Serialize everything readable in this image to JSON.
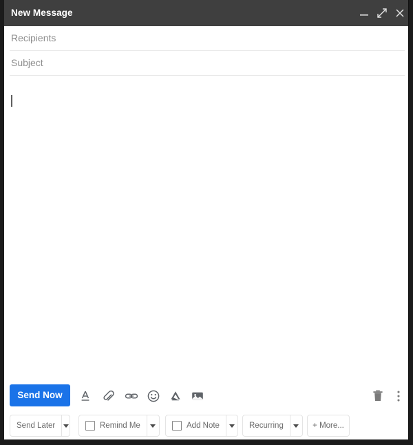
{
  "window": {
    "title": "New Message",
    "controls": {
      "minimize": "minimize-icon",
      "maximize": "expand-icon",
      "close": "close-icon"
    },
    "titlebar_color": "#3f3f3f"
  },
  "fields": {
    "recipients_placeholder": "Recipients",
    "subject_placeholder": "Subject",
    "recipients_value": "",
    "subject_value": ""
  },
  "body": {
    "value": "",
    "caret_visible": true
  },
  "toolbar": {
    "send_label": "Send Now",
    "send_color": "#1a73e8",
    "icons": [
      {
        "name": "format-text-icon",
        "glyph": "A-underline"
      },
      {
        "name": "attach-file-icon",
        "glyph": "paperclip"
      },
      {
        "name": "insert-link-icon",
        "glyph": "chain-link"
      },
      {
        "name": "insert-emoji-icon",
        "glyph": "smiley-face"
      },
      {
        "name": "google-drive-icon",
        "glyph": "drive-triangle"
      },
      {
        "name": "insert-photo-icon",
        "glyph": "image"
      }
    ],
    "right_icons": [
      {
        "name": "discard-draft-icon",
        "glyph": "trash-can"
      },
      {
        "name": "more-options-icon",
        "glyph": "vertical-dots"
      }
    ]
  },
  "actions": [
    {
      "label": "Send Later",
      "checkbox": false,
      "caret": true
    },
    {
      "label": "Remind Me",
      "checkbox": true,
      "caret": true
    },
    {
      "label": "Add Note",
      "checkbox": true,
      "caret": true
    },
    {
      "label": "Recurring",
      "checkbox": false,
      "caret": true
    },
    {
      "label": "+ More...",
      "checkbox": false,
      "caret": false
    }
  ]
}
